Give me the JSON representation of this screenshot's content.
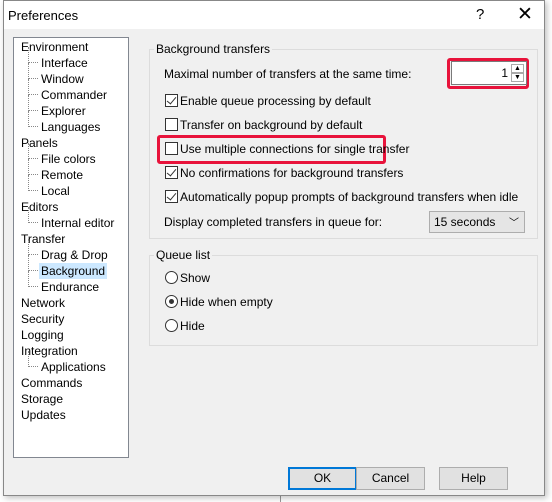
{
  "window": {
    "title": "Preferences",
    "help_glyph": "?",
    "close_glyph": "✕"
  },
  "tree": [
    {
      "label": "Environment",
      "level": 0
    },
    {
      "label": "Interface",
      "level": 1
    },
    {
      "label": "Window",
      "level": 1
    },
    {
      "label": "Commander",
      "level": 1
    },
    {
      "label": "Explorer",
      "level": 1
    },
    {
      "label": "Languages",
      "level": 1
    },
    {
      "label": "Panels",
      "level": 0
    },
    {
      "label": "File colors",
      "level": 1
    },
    {
      "label": "Remote",
      "level": 1
    },
    {
      "label": "Local",
      "level": 1
    },
    {
      "label": "Editors",
      "level": 0
    },
    {
      "label": "Internal editor",
      "level": 1
    },
    {
      "label": "Transfer",
      "level": 0
    },
    {
      "label": "Drag & Drop",
      "level": 1
    },
    {
      "label": "Background",
      "level": 1,
      "selected": true
    },
    {
      "label": "Endurance",
      "level": 1
    },
    {
      "label": "Network",
      "level": 0
    },
    {
      "label": "Security",
      "level": 0
    },
    {
      "label": "Logging",
      "level": 0
    },
    {
      "label": "Integration",
      "level": 0
    },
    {
      "label": "Applications",
      "level": 1
    },
    {
      "label": "Commands",
      "level": 0
    },
    {
      "label": "Storage",
      "level": 0
    },
    {
      "label": "Updates",
      "level": 0
    }
  ],
  "background": {
    "group_label": "Background transfers",
    "max_transfers_label": "Maximal number of transfers at the same time:",
    "max_transfers_value": "1",
    "options": [
      {
        "label": "Enable queue processing by default",
        "checked": true
      },
      {
        "label": "Transfer on background by default",
        "checked": false
      },
      {
        "label": "Use multiple connections for single transfer",
        "checked": false
      },
      {
        "label": "No confirmations for background transfers",
        "checked": true
      },
      {
        "label": "Automatically popup prompts of background transfers when idle",
        "checked": true
      }
    ],
    "display_completed_label": "Display completed transfers in queue for:",
    "display_completed_value": "15 seconds"
  },
  "queue": {
    "group_label": "Queue list",
    "options": [
      {
        "label": "Show",
        "selected": false
      },
      {
        "label": "Hide when empty",
        "selected": true
      },
      {
        "label": "Hide",
        "selected": false
      }
    ]
  },
  "buttons": {
    "ok": "OK",
    "cancel": "Cancel",
    "help": "Help"
  },
  "colors": {
    "highlight": "#e8133b",
    "selection": "#cce8ff",
    "default_button": "#0078d7"
  }
}
